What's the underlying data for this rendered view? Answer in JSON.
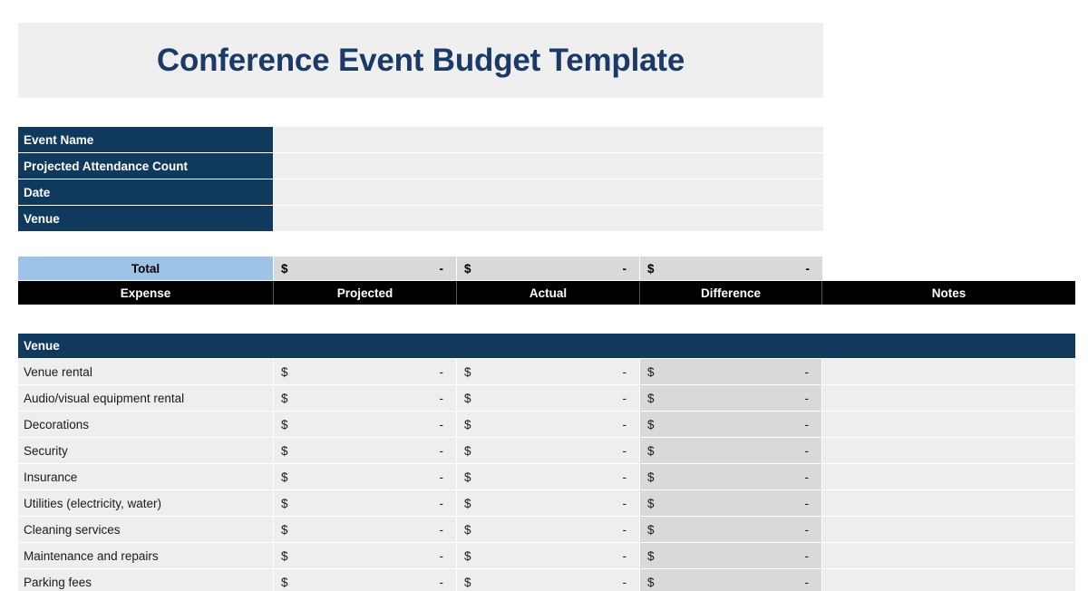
{
  "document": {
    "title": "Conference Event Budget Template"
  },
  "event_info": {
    "rows": [
      {
        "label": "Event Name",
        "value": ""
      },
      {
        "label": "Projected Attendance Count",
        "value": ""
      },
      {
        "label": "Date",
        "value": ""
      },
      {
        "label": "Venue",
        "value": ""
      }
    ]
  },
  "summary": {
    "total_label": "Total",
    "totals": [
      {
        "symbol": "$",
        "amount": "-"
      },
      {
        "symbol": "$",
        "amount": "-"
      },
      {
        "symbol": "$",
        "amount": "-"
      }
    ]
  },
  "columns": {
    "expense": "Expense",
    "projected": "Projected",
    "actual": "Actual",
    "difference": "Difference",
    "notes": "Notes"
  },
  "sections": [
    {
      "name": "Venue",
      "rows": [
        {
          "name": "Venue rental",
          "projected_symbol": "$",
          "projected_amount": "-",
          "actual_symbol": "$",
          "actual_amount": "-",
          "difference_symbol": "$",
          "difference_amount": "-",
          "notes": ""
        },
        {
          "name": "Audio/visual equipment rental",
          "projected_symbol": "$",
          "projected_amount": "-",
          "actual_symbol": "$",
          "actual_amount": "-",
          "difference_symbol": "$",
          "difference_amount": "-",
          "notes": ""
        },
        {
          "name": "Decorations",
          "projected_symbol": "$",
          "projected_amount": "-",
          "actual_symbol": "$",
          "actual_amount": "-",
          "difference_symbol": "$",
          "difference_amount": "-",
          "notes": ""
        },
        {
          "name": "Security",
          "projected_symbol": "$",
          "projected_amount": "-",
          "actual_symbol": "$",
          "actual_amount": "-",
          "difference_symbol": "$",
          "difference_amount": "-",
          "notes": ""
        },
        {
          "name": "Insurance",
          "projected_symbol": "$",
          "projected_amount": "-",
          "actual_symbol": "$",
          "actual_amount": "-",
          "difference_symbol": "$",
          "difference_amount": "-",
          "notes": ""
        },
        {
          "name": "Utilities (electricity, water)",
          "projected_symbol": "$",
          "projected_amount": "-",
          "actual_symbol": "$",
          "actual_amount": "-",
          "difference_symbol": "$",
          "difference_amount": "-",
          "notes": ""
        },
        {
          "name": "Cleaning services",
          "projected_symbol": "$",
          "projected_amount": "-",
          "actual_symbol": "$",
          "actual_amount": "-",
          "difference_symbol": "$",
          "difference_amount": "-",
          "notes": ""
        },
        {
          "name": "Maintenance and repairs",
          "projected_symbol": "$",
          "projected_amount": "-",
          "actual_symbol": "$",
          "actual_amount": "-",
          "difference_symbol": "$",
          "difference_amount": "-",
          "notes": ""
        },
        {
          "name": "Parking fees",
          "projected_symbol": "$",
          "projected_amount": "-",
          "actual_symbol": "$",
          "actual_amount": "-",
          "difference_symbol": "$",
          "difference_amount": "-",
          "notes": ""
        }
      ]
    }
  ],
  "colors": {
    "header_navy": "#103a5d",
    "title_navy": "#1b3a68",
    "total_blue": "#9dc3e6",
    "column_header_black": "#000000",
    "cell_light": "#eeeeee",
    "cell_dark": "#d9d9d9",
    "banner_gray": "#efefef"
  }
}
